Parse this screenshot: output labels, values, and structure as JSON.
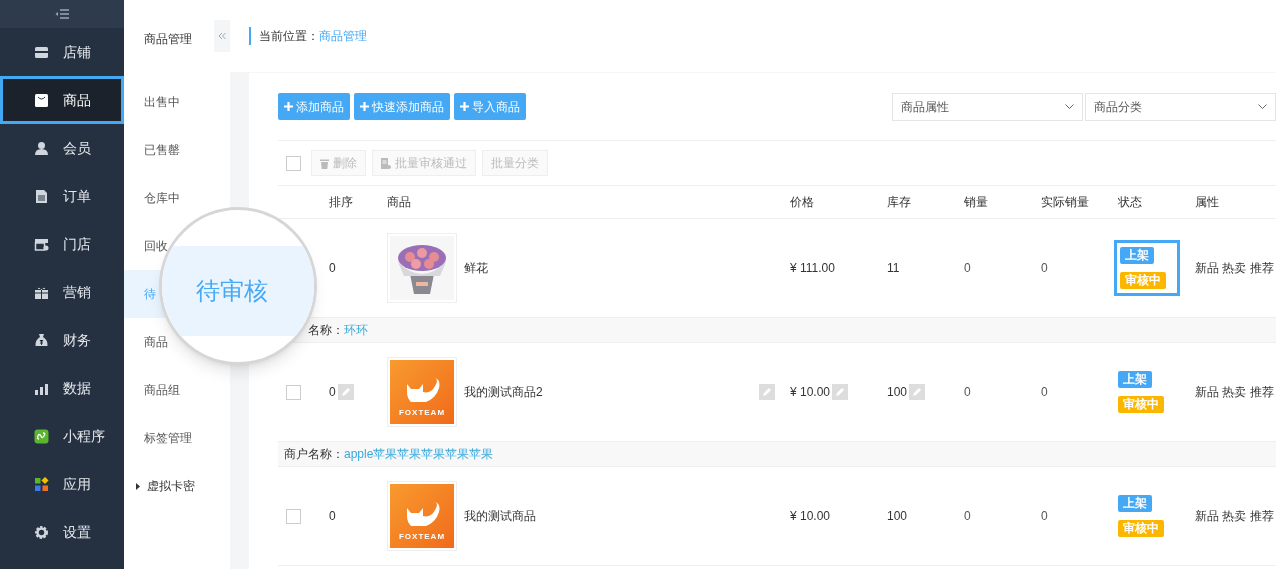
{
  "sidebar": {
    "items": [
      {
        "label": "店铺",
        "selected": false
      },
      {
        "label": "商品",
        "selected": true
      },
      {
        "label": "会员",
        "selected": false
      },
      {
        "label": "订单",
        "selected": false
      },
      {
        "label": "门店",
        "selected": false
      },
      {
        "label": "营销",
        "selected": false
      },
      {
        "label": "财务",
        "selected": false
      },
      {
        "label": "数据",
        "selected": false
      },
      {
        "label": "小程序",
        "selected": false
      },
      {
        "label": "应用",
        "selected": false
      },
      {
        "label": "设置",
        "selected": false
      }
    ]
  },
  "subnav": {
    "title": "商品管理",
    "items": [
      {
        "label": "出售中",
        "kind": "item",
        "selected": false
      },
      {
        "label": "已售罄",
        "kind": "item",
        "selected": false
      },
      {
        "label": "仓库中",
        "kind": "item",
        "selected": false
      },
      {
        "label": "回收",
        "kind": "item",
        "selected": false
      },
      {
        "label": "待",
        "kind": "item",
        "selected": true
      },
      {
        "label": "商品",
        "kind": "item",
        "selected": false
      },
      {
        "label": "商品组",
        "kind": "item",
        "selected": false
      },
      {
        "label": "标签管理",
        "kind": "item",
        "selected": false
      },
      {
        "label": "虚拟卡密",
        "kind": "group",
        "expanded": false
      }
    ]
  },
  "magnifier": {
    "label": "待审核"
  },
  "breadcrumb": {
    "label": "当前位置：",
    "current": "商品管理"
  },
  "actions": [
    "添加商品",
    "快速添加商品",
    "导入商品"
  ],
  "filters": [
    {
      "placeholder": "商品属性"
    },
    {
      "placeholder": "商品分类"
    }
  ],
  "bulk": {
    "checked": false,
    "buttons": [
      "删除",
      "批量审核通过",
      "批量分类"
    ]
  },
  "table": {
    "columns": [
      "排序",
      "商品",
      "价格",
      "库存",
      "销量",
      "实际销量",
      "状态",
      "属性"
    ],
    "rows": [
      {
        "sort": "0",
        "name": "鲜花",
        "price": "¥ 111.00",
        "stock": "11",
        "sales": "0",
        "real_sales": "0",
        "editable": false,
        "highlighted": true,
        "status": [
          {
            "label": "上架",
            "color": "#45a8f5"
          },
          {
            "label": "审核中",
            "color": "#fbb700"
          }
        ],
        "attributes": "新品 热卖 推荐"
      },
      {
        "merchant": {
          "label": "名称：",
          "name": "环环"
        },
        "checked": false,
        "sort": "0",
        "logo_text": "FOXTEAM",
        "name": "我的测试商品2",
        "price": "¥ 10.00",
        "stock": "100",
        "sales": "0",
        "real_sales": "0",
        "editable": true,
        "highlighted": false,
        "status": [
          {
            "label": "上架",
            "color": "#45a8f5"
          },
          {
            "label": "审核中",
            "color": "#fbb700"
          }
        ],
        "attributes": "新品 热卖 推荐"
      },
      {
        "merchant": {
          "label": "商户名称：",
          "name": "apple苹果苹果苹果苹果苹果"
        },
        "checked": false,
        "sort": "0",
        "logo_text": "FOXTEAM",
        "name": "我的测试商品",
        "price": "¥ 10.00",
        "stock": "100",
        "sales": "0",
        "real_sales": "0",
        "editable": false,
        "highlighted": false,
        "status": [
          {
            "label": "上架",
            "color": "#45a8f5"
          },
          {
            "label": "审核中",
            "color": "#fbb700"
          }
        ],
        "attributes": "新品 热卖 推荐"
      }
    ]
  }
}
